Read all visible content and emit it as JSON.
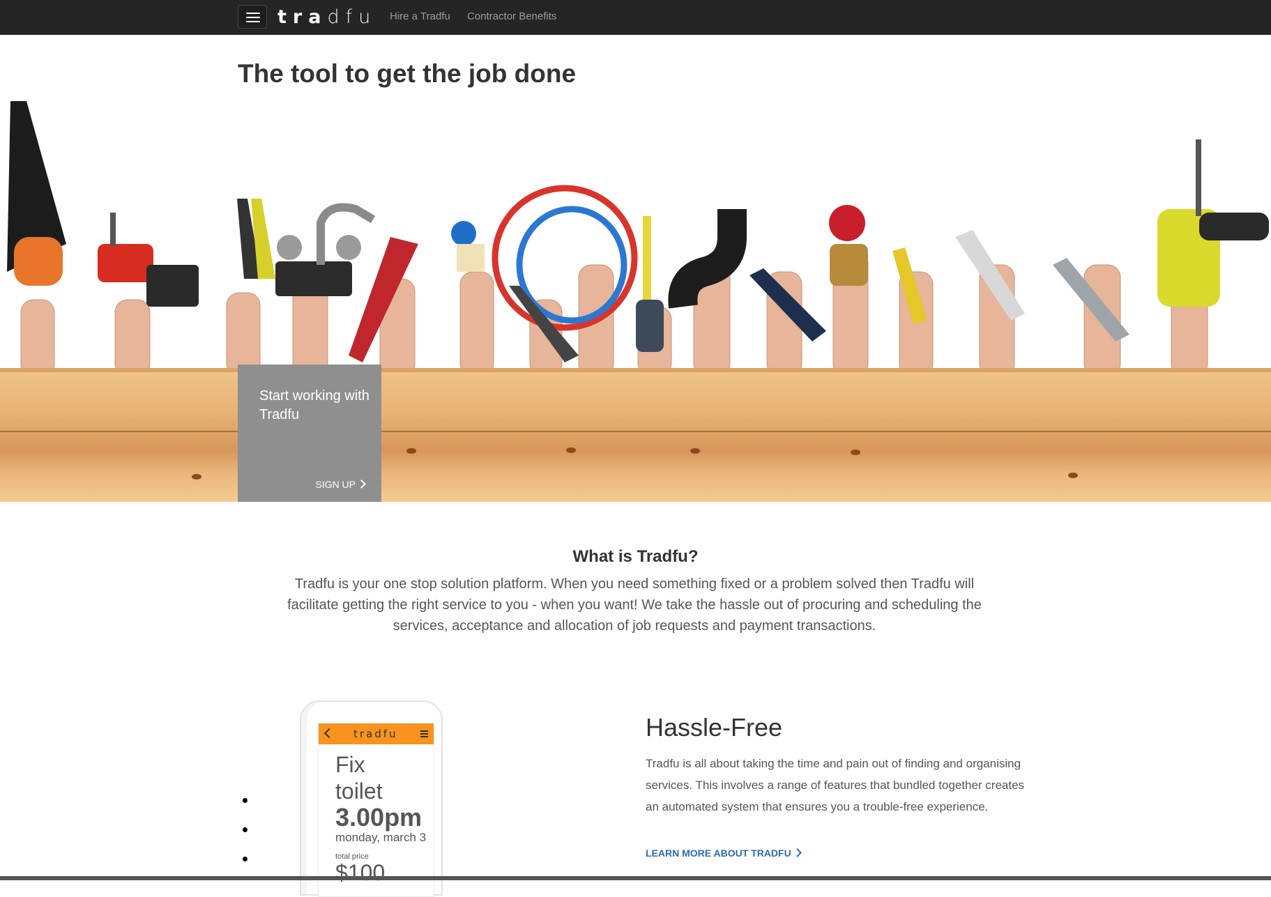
{
  "navbar": {
    "brand_bold": "tra",
    "brand_light": "dfu",
    "links": [
      "Hire a Tradfu",
      "Contractor Benefits"
    ]
  },
  "hero": {
    "title": "The tool to get the job done",
    "card": {
      "title": "Start working with Tradfu",
      "link_label": "SIGN UP"
    }
  },
  "what_is": {
    "title": "What is Tradfu?",
    "body": "Tradfu is your one stop solution platform. When you need something fixed or a problem solved then Tradfu will facilitate getting the right service to you - when you want! We take the hassle out of procuring and scheduling the services, acceptance and allocation of job requests and payment transactions."
  },
  "feature": {
    "title": "Hassle-Free",
    "body": "Tradfu is all about taking the time and pain out of finding and organising services. This involves a range of features that bundled together creates an automated system that ensures you a trouble-free experience.",
    "link_label": "LEARN MORE ABOUT TRADFU"
  },
  "phone_mockup": {
    "logo": "tradfu",
    "job_line1": "Fix",
    "job_line2": "toilet",
    "time": "3.00pm",
    "date": "monday, march 3",
    "price_label": "total price",
    "price": "$100"
  },
  "colors": {
    "navbar_bg": "#252525",
    "card_bg": "#8f8f8f",
    "app_accent": "#f7931e",
    "link_blue": "#2b6cb0"
  },
  "icons": [
    "menu-icon",
    "chevron-right-icon",
    "back-arrow-icon"
  ]
}
